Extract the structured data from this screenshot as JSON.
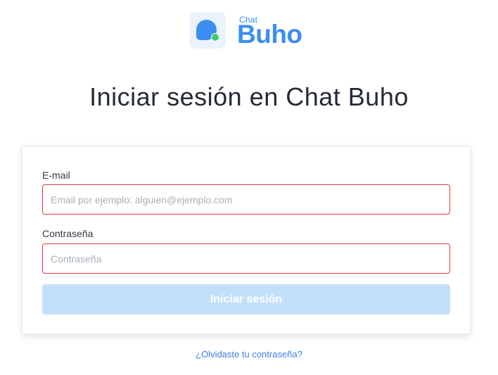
{
  "brand": {
    "small_text": "Chat",
    "big_text": "Buho",
    "color": "#3b8ef0",
    "dot_color": "#35d06b"
  },
  "page": {
    "title": "Iniciar sesión en Chat Buho"
  },
  "form": {
    "email": {
      "label": "E-mail",
      "value": "",
      "placeholder": "Email por ejemplo: alguien@ejemplo.com",
      "border_color": "#e0393e"
    },
    "password": {
      "label": "Contraseña",
      "value": "",
      "placeholder": "Contraseña",
      "border_color": "#e0393e"
    },
    "submit_label": "Iniciar sesión",
    "submit_color": "#c3e0fb"
  },
  "links": {
    "forgot_password": "¿Olvidaste tu contraseña?"
  }
}
